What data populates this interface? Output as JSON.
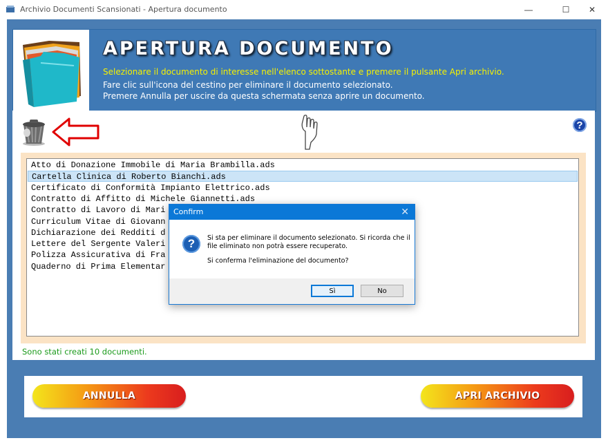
{
  "window": {
    "title": "Archivio Documenti Scansionati - Apertura documento",
    "minimize": "—",
    "maximize": "☐",
    "close": "✕"
  },
  "header": {
    "title": "APERTURA DOCUMENTO",
    "line1": "Selezionare il documento di interesse nell'elenco sottostante e premere il pulsante Apri archivio.",
    "line2": "Fare clic sull'icona del cestino per eliminare il documento selezionato.",
    "line3": "Premere Annulla per uscire da questa schermata senza aprire un documento."
  },
  "toolbar": {
    "help_label": "?"
  },
  "documents": [
    "Atto di Donazione Immobile di Maria Brambilla.ads",
    "Cartella Clinica di Roberto Bianchi.ads",
    "Certificato di Conformità Impianto Elettrico.ads",
    "Contratto di Affitto di Michele Giannetti.ads",
    "Contratto di Lavoro di Mari",
    "Curriculum Vitae di Giovann",
    "Dichiarazione dei Redditi d",
    "Lettere del Sergente Valeri",
    "Polizza Assicurativa di Fra",
    "Quaderno di Prima Elementar"
  ],
  "selected_index": 1,
  "status": "Sono stati creati 10 documenti.",
  "buttons": {
    "cancel": "ANNULLA",
    "open": "APRI ARCHIVIO"
  },
  "dialog": {
    "title": "Confirm",
    "close": "✕",
    "icon": "?",
    "message_line1": "Si sta per eliminare il documento selezionato. Si ricorda che il",
    "message_line2": "file eliminato non potrà essere recuperato.",
    "message_line3": "Si conferma l'eliminazione del documento?",
    "yes": "Sì",
    "no": "No"
  },
  "colors": {
    "frame": "#4a7db3",
    "header": "#3f79b5",
    "header_highlight": "#f7f200",
    "list_frame": "#fbe3c5",
    "status": "#1a9a1a",
    "dialog_title": "#0b78d7"
  }
}
